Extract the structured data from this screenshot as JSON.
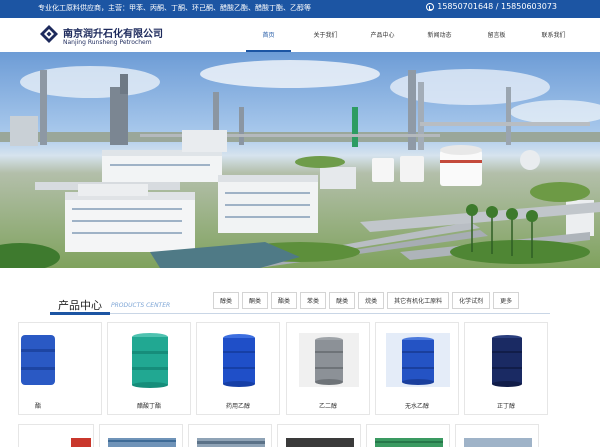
{
  "topbar": {
    "slogan": "专业化工原料供应商，主营：甲苯、丙酮、丁酮、环己酮、醋酸乙酯、醋酸丁酯、乙醇等",
    "phone": "15850701648 / 15850603073",
    "phone_icon": "phone-icon"
  },
  "brand": {
    "name_cn": "南京润升石化有限公司",
    "name_en": "Nanjing Runsheng Petrochem",
    "logo_icon": "diamond-logo-icon"
  },
  "nav": {
    "items": [
      {
        "label": "首页",
        "active": true
      },
      {
        "label": "关于我们",
        "active": false
      },
      {
        "label": "产品中心",
        "active": false
      },
      {
        "label": "新闻动态",
        "active": false
      },
      {
        "label": "留言板",
        "active": false
      },
      {
        "label": "联系我们",
        "active": false
      }
    ]
  },
  "products": {
    "title": "产品中心",
    "title_en": "PRODUCTS CENTER",
    "tabs": [
      "醇类",
      "酮类",
      "酯类",
      "苯类",
      "醚类",
      "烷类",
      "其它有机化工原料",
      "化学试剂",
      "更多"
    ],
    "items": [
      {
        "name": "酯",
        "drum": "blue"
      },
      {
        "name": "醋酸丁酯",
        "drum": "teal"
      },
      {
        "name": "药用乙醇",
        "drum": "blue"
      },
      {
        "name": "乙二醇",
        "drum": "steel"
      },
      {
        "name": "无水乙醇",
        "drum": "blue"
      },
      {
        "name": "正丁醇",
        "drum": "navy"
      }
    ]
  },
  "colors": {
    "brand_blue": "#1c55a3",
    "logo_navy": "#1d2a5c",
    "subtitle_blue": "#7ea6d6"
  }
}
